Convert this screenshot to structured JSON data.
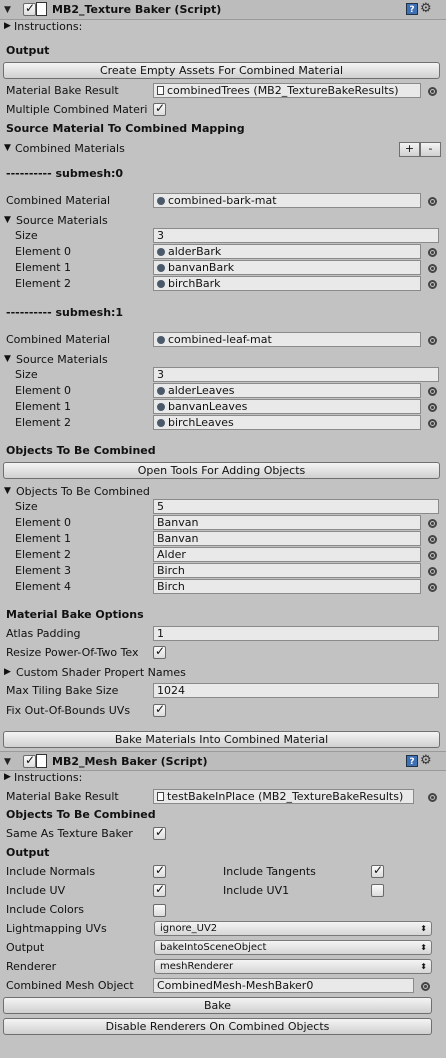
{
  "texture_baker": {
    "title": "MB2_Texture Baker (Script)",
    "instructions": "Instructions:",
    "output_heading": "Output",
    "create_assets_button": "Create Empty Assets For Combined Material",
    "material_bake_result_label": "Material Bake Result",
    "material_bake_result_value": "combinedTrees (MB2_TextureBakeResults)",
    "multiple_combined_label": "Multiple Combined Materi",
    "multiple_combined_checked": true,
    "mapping_heading": "Source Material To Combined Mapping",
    "combined_materials_label": "Combined Materials",
    "add_label": "+",
    "remove_label": "-",
    "submeshes": [
      {
        "title": "---------- submesh:0",
        "combined_material_label": "Combined Material",
        "combined_material_value": "combined-bark-mat",
        "source_materials_label": "Source Materials",
        "size_label": "Size",
        "size_value": "3",
        "elements": [
          {
            "label": "Element 0",
            "value": "alderBark"
          },
          {
            "label": "Element 1",
            "value": "banvanBark"
          },
          {
            "label": "Element 2",
            "value": "birchBark"
          }
        ]
      },
      {
        "title": "---------- submesh:1",
        "combined_material_label": "Combined Material",
        "combined_material_value": "combined-leaf-mat",
        "source_materials_label": "Source Materials",
        "size_label": "Size",
        "size_value": "3",
        "elements": [
          {
            "label": "Element 0",
            "value": "alderLeaves"
          },
          {
            "label": "Element 1",
            "value": "banvanLeaves"
          },
          {
            "label": "Element 2",
            "value": "birchLeaves"
          }
        ]
      }
    ],
    "objects_heading": "Objects To Be Combined",
    "open_tools_button": "Open Tools For Adding Objects",
    "objects_foldout": "Objects To Be Combined",
    "objects_size_label": "Size",
    "objects_size_value": "5",
    "objects": [
      {
        "label": "Element 0",
        "value": "Banvan"
      },
      {
        "label": "Element 1",
        "value": "Banvan"
      },
      {
        "label": "Element 2",
        "value": "Alder"
      },
      {
        "label": "Element 3",
        "value": "Birch"
      },
      {
        "label": "Element 4",
        "value": "Birch"
      }
    ],
    "bake_options_heading": "Material Bake Options",
    "atlas_padding_label": "Atlas Padding",
    "atlas_padding_value": "1",
    "resize_label": "Resize Power-Of-Two Tex",
    "resize_checked": true,
    "custom_shader_label": "Custom Shader Propert Names",
    "max_tiling_label": "Max Tiling Bake Size",
    "max_tiling_value": "1024",
    "fix_uvs_label": "Fix Out-Of-Bounds UVs",
    "fix_uvs_checked": true,
    "bake_materials_button": "Bake Materials Into Combined Material"
  },
  "mesh_baker": {
    "title": "MB2_Mesh Baker (Script)",
    "instructions": "Instructions:",
    "material_bake_result_label": "Material Bake Result",
    "material_bake_result_value": "testBakeInPlace (MB2_TextureBakeResults)",
    "objects_heading": "Objects To Be Combined",
    "same_as_label": "Same As Texture Baker",
    "same_as_checked": true,
    "output_heading": "Output",
    "include_normals_label": "Include Normals",
    "include_normals_checked": true,
    "include_tangents_label": "Include Tangents",
    "include_tangents_checked": true,
    "include_uv_label": "Include UV",
    "include_uv_checked": true,
    "include_uv1_label": "Include UV1",
    "include_uv1_checked": false,
    "include_colors_label": "Include Colors",
    "include_colors_checked": false,
    "lightmapping_label": "Lightmapping UVs",
    "lightmapping_value": "ignore_UV2",
    "output_label": "Output",
    "output_value": "bakeIntoSceneObject",
    "renderer_label": "Renderer",
    "renderer_value": "meshRenderer",
    "combined_mesh_label": "Combined Mesh Object",
    "combined_mesh_value": "CombinedMesh-MeshBaker0",
    "bake_button": "Bake",
    "disable_renderers_button": "Disable Renderers On Combined Objects"
  },
  "icons": {
    "foldout_open": "▼",
    "foldout_closed": "▶",
    "help": "?",
    "gear": "⚙",
    "popup_arrow": "⬍"
  }
}
